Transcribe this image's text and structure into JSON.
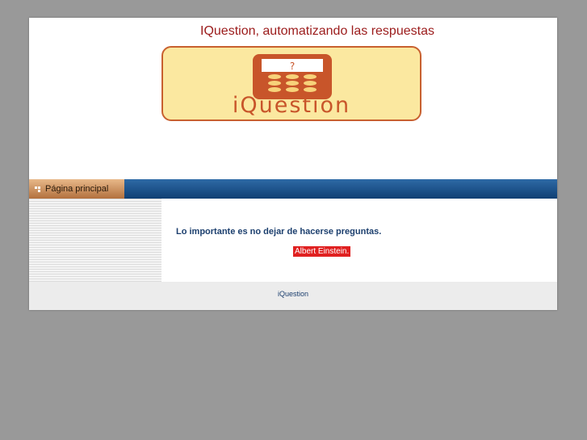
{
  "header": {
    "title": "IQuestion, automatizando las respuestas",
    "logo": {
      "text": "iQuestion",
      "screen_glyph": "?",
      "colors": {
        "fill": "#fbe8a0",
        "border": "#c8602f",
        "phone": "#c8552a"
      }
    }
  },
  "nav": {
    "items": [
      {
        "label": "Página principal",
        "icon": "bullet-icon"
      }
    ],
    "colors": {
      "bar": "#1f5590",
      "active_tab": "#d19462"
    }
  },
  "main": {
    "quote": "Lo importante es no dejar de hacerse preguntas.",
    "author": "Albert Einstein.",
    "colors": {
      "quote": "#1c3f6e",
      "author_bg": "#e02020"
    }
  },
  "footer": {
    "text": "iQuestion"
  },
  "colors": {
    "page_bg": "#999999",
    "title": "#9b1b1b"
  }
}
